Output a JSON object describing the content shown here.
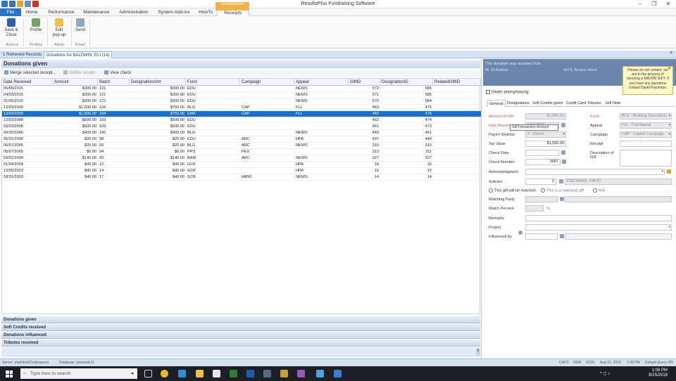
{
  "app": {
    "title": "ResultsPlus Fundraising Software",
    "minimize": "–",
    "restore": "❐",
    "close": "✕"
  },
  "menu": {
    "file": "File",
    "tabs": [
      "Home",
      "Performance",
      "Maintenance",
      "Administration",
      "System Add-ins",
      "HowTo",
      "Receipts"
    ],
    "context_tab": "Contributions"
  },
  "ribbon": {
    "buttons": [
      {
        "label": "Save &\nClose",
        "icon": "save-icon"
      },
      {
        "label": "Profile",
        "icon": "profile-icon"
      },
      {
        "label": "Edit\npop-up",
        "icon": "edit-popup-icon"
      },
      {
        "label": "Send",
        "icon": "send-icon"
      }
    ],
    "groups": [
      "Actions",
      "Profiles",
      "Alerts",
      "Email"
    ]
  },
  "doc_tabs": [
    "1 Retrieved Records",
    "Donations for BALDWIN, ELI (14)"
  ],
  "donations": {
    "header": "Donations given",
    "toolbar": [
      "Merge selected receipt...",
      "Delete receipt",
      "View check"
    ],
    "columns": [
      "Date Received",
      "Amount",
      "Batch",
      "DesignationAmt",
      "Fund",
      "Campaign",
      "Appeal",
      "GiftID",
      "DesignationID",
      "RelatedGiftID"
    ],
    "rows": [
      [
        "06/05/2015",
        "$300.00",
        "121",
        "$300.00",
        "EDU",
        "",
        "NEWS",
        "572",
        "586",
        ""
      ],
      [
        "04/03/2015",
        "$300.00",
        "121",
        "$300.00",
        "EDU",
        "",
        "NEWS",
        "571",
        "585",
        ""
      ],
      [
        "01/05/2015",
        "$300.00",
        "121",
        "$300.00",
        "EDU",
        "",
        "NEWS",
        "570",
        "584",
        ""
      ],
      [
        "12/03/2009",
        "$1,500.00",
        "104",
        "$750.00",
        "BLG",
        "CAP",
        "FLL",
        "463",
        "475",
        ""
      ],
      [
        "12/03/2009",
        "$1,500.00",
        "104",
        "$750.00",
        "CMF",
        "CAP",
        "FLL",
        "463",
        "476",
        ""
      ],
      [
        "12/03/2008",
        "$500.00",
        "103",
        "$500.00",
        "EDU",
        "",
        "",
        "462",
        "474",
        ""
      ],
      [
        "03/03/2008",
        "$500.00",
        "103",
        "$500.00",
        "EDU",
        "",
        "",
        "461",
        "473",
        ""
      ],
      [
        "09/20/2006",
        "$400.00",
        "100",
        "$400.00",
        "BLG",
        "",
        "NEWS",
        "449",
        "461",
        ""
      ],
      [
        "05/01/2006",
        "$25.00",
        "98",
        "$25.00",
        "EDU",
        "ARC",
        "HPA",
        "437",
        "449",
        ""
      ],
      [
        "06/07/2005",
        "$25.00",
        "93",
        "$25.00",
        "BLG",
        "ARC",
        "NEWS",
        "315",
        "315",
        ""
      ],
      [
        "05/07/2005",
        "$0.00",
        "94",
        "$0.00",
        "PPS",
        "PEX",
        "",
        "313",
        "311",
        ""
      ],
      [
        "09/01/2004",
        "$140.00",
        "93",
        "$140.00",
        "BAM",
        "ARC",
        "NEWS",
        "327",
        "327",
        ""
      ],
      [
        "01/04/2004",
        "$40.00",
        "12",
        "$40.00",
        "GOF",
        "",
        "HPA",
        "16",
        "16",
        ""
      ],
      [
        "12/05/2003",
        "$40.00",
        "14",
        "$40.00",
        "GOF",
        "",
        "HPA",
        "15",
        "15",
        ""
      ],
      [
        "10/31/2003",
        "$40.00",
        "17",
        "$40.00",
        "GOF",
        "HMW",
        "NEWS",
        "14",
        "14",
        ""
      ]
    ],
    "selected_row": 4,
    "sections": [
      "Donations given",
      "Soft Credits received",
      "Donations influenced",
      "Tributes received"
    ]
  },
  "detail": {
    "header_line": "This donation was received from",
    "donor_name": "Mr. Eli Baldwin",
    "donor_address": "432 E. Beacon Street",
    "alert": "Please do not contact; we are in the process of securing a MAJOR GIFT. If you have any questions contact David Fischman.",
    "alert_close": "✕",
    "anonymous_label": "Given anonymously",
    "tabs": [
      "General",
      "Designations",
      "Soft Credits given",
      "Credit Card",
      "Tributes",
      "Gift Note"
    ],
    "fields": {
      "amount_label": "Amount of Gift",
      "amount": "$1,500.00",
      "date_label": "Date Received",
      "date": "12/3/2009",
      "tooltip": "GiftTransaction.Amount",
      "method_label": "Paym't Method",
      "method": "2 - Check",
      "tax_label": "Tax Value",
      "tax": "$1,500.00",
      "check_date_label": "Check Date",
      "check_number_label": "Check Number",
      "check_number": "3457",
      "ack_label": "Acknowledgment",
      "solicitor_label": "Solicitor",
      "solicitor_id": "2",
      "solicitor_name": "FISCHMAN, DAVID",
      "matched_label": "This gift will be matched",
      "matching_gift_label": "This is a matching gift",
      "na_label": "N/A",
      "matching_party_label": "Matching Party",
      "match_percent_label": "Match Percent",
      "percent_sign": "%",
      "remarks_label": "Remarks",
      "project_label": "Project",
      "influenced_label": "Influenced by",
      "fund_label": "Fund",
      "fund": "BLG - Building Operations",
      "appeal_label": "Appeal",
      "appeal": "FLL - Fall Appeal",
      "campaign_label": "Campaign",
      "campaign": "CAP - Capital Campaign",
      "receipt_label": "Receipt",
      "desc_label": "Description of Gift"
    }
  },
  "status": {
    "server": "Server: rmplhbob2\\sqlexpress",
    "database": "Database: rpsample11",
    "caps": "CAPS",
    "num": "NUM",
    "scrl": "SCRL",
    "date": "Aug 15, 2018",
    "time": "1:08 PM",
    "query": "Default Query ON"
  },
  "taskbar": {
    "search_placeholder": "Type here to search",
    "clock_time": "1:08 PM",
    "clock_date": "8/15/2018"
  },
  "colors": {
    "file_tab": "#2b74c7",
    "selected_row": "#1b6fd1",
    "context_tab": "#f2b14a",
    "alert_bg": "#fff7c4",
    "required_label": "#d9534f"
  }
}
